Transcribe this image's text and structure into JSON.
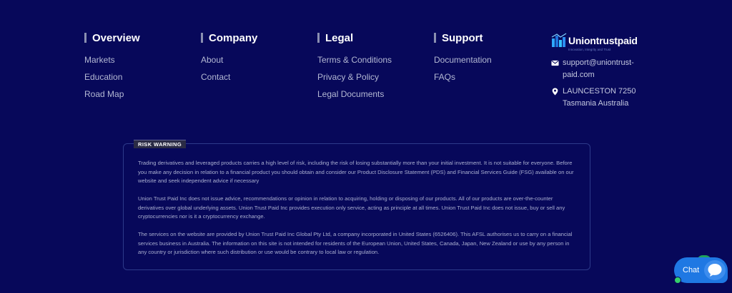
{
  "columns": [
    {
      "title": "Overview",
      "links": [
        "Markets",
        "Education",
        "Road Map"
      ]
    },
    {
      "title": "Company",
      "links": [
        "About",
        "Contact"
      ]
    },
    {
      "title": "Legal",
      "links": [
        "Terms & Conditions",
        "Privacy & Policy",
        "Legal Documents"
      ]
    },
    {
      "title": "Support",
      "links": [
        "Documentation",
        "FAQs"
      ]
    }
  ],
  "brand": {
    "logo_text": "Uniontrustpaid",
    "tagline": "Innovation, Integrity and Trust",
    "email_line1": "support@uniontrust-",
    "email_line2": "paid.com",
    "address_line1": "LAUNCESTON 7250",
    "address_line2": "Tasmania Australia",
    "email_icon": "envelope-icon",
    "address_icon": "map-pin-icon"
  },
  "risk_warning": {
    "tag": "RISK WARNING",
    "paragraphs": [
      "Trading derivatives and leveraged products carries a high level of risk, including the risk of losing substantially more than your initial investment. It is not suitable for everyone. Before you make any decision in relation to a financial product you should obtain and consider our Product Disclosure Statement (PDS) and Financial Services Guide (FSG) available on our website and seek independent advice if necessary",
      "Union Trust Paid Inc does not issue advice, recommendations or opinion in relation to acquiring, holding or disposing of our products. All of our products are over-the-counter derivatives over global underlying assets. Union Trust Paid Inc provides execution only service, acting as principle at all times. Union Trust Paid Inc does not issue, buy or sell any cryptocurrencies nor is it a cryptocurrency exchange.",
      "The services on the website are provided by Union Trust Paid Inc Global Pty Ltd, a company incorporated in United States (6526406). This AFSL authorises us to carry on a financial services business in Australia. The information on this site is not intended for residents of the European Union, United States, Canada, Japan, New Zealand or use by any person in any country or jurisdiction where such distribution or use would be contrary to local law or regulation."
    ]
  },
  "chat": {
    "label": "Chat",
    "icon": "chat-bubble-icon"
  },
  "colors": {
    "background": "#07085a",
    "accent": "#1f78e3",
    "online": "#35d06b"
  }
}
